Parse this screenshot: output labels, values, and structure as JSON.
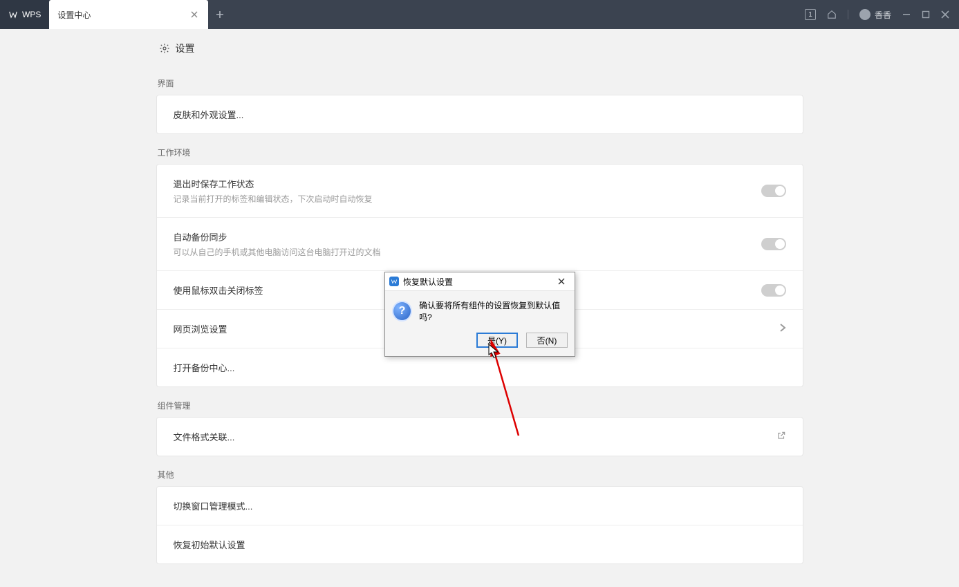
{
  "titlebar": {
    "wps_tab_label": "WPS",
    "settings_tab_label": "设置中心",
    "badge_text": "1",
    "username": "香香"
  },
  "page": {
    "title": "设置"
  },
  "sections": {
    "interface": {
      "label": "界面",
      "skin_row": "皮肤和外观设置..."
    },
    "work_env": {
      "label": "工作环境",
      "exit_save": {
        "title": "退出时保存工作状态",
        "sub": "记录当前打开的标签和编辑状态，下次启动时自动恢复"
      },
      "auto_backup": {
        "title": "自动备份同步",
        "sub": "可以从自己的手机或其他电脑访问这台电脑打开过的文档"
      },
      "dblclick_close": "使用鼠标双击关闭标签",
      "web_browse": "网页浏览设置",
      "open_backup": "打开备份中心..."
    },
    "component": {
      "label": "组件管理",
      "file_assoc": "文件格式关联..."
    },
    "other": {
      "label": "其他",
      "window_mode": "切换窗口管理模式...",
      "restore_defaults": "恢复初始默认设置"
    }
  },
  "dialog": {
    "title": "恢复默认设置",
    "message": "确认要将所有组件的设置恢复到默认值吗?",
    "yes": "是(Y)",
    "no": "否(N)"
  }
}
